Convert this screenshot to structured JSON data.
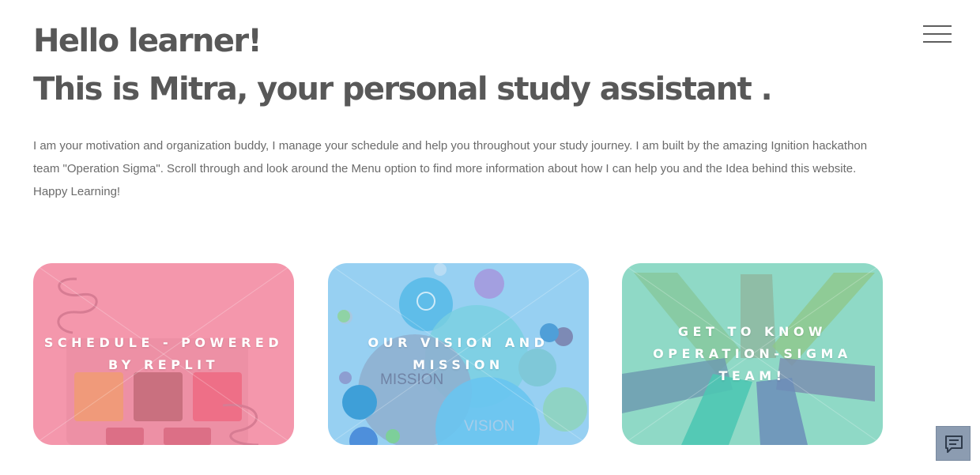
{
  "header": {
    "greeting": "Hello learner!",
    "title": "This is Mitra, your personal study assistant ."
  },
  "intro": {
    "text": "I am your motivation and organization buddy, I manage your schedule and help you throughout your study journey. I am built by the amazing Ignition hackathon team \"Operation Sigma\". Scroll through and look around the Menu option to find more information about how I can help you and the Idea behind this website. Happy Learning!"
  },
  "menu": {
    "icon": "hamburger-menu-icon"
  },
  "cards": [
    {
      "label": "SCHEDULE - POWERED BY REPLIT",
      "color": "#f497ac"
    },
    {
      "label": "OUR VISION AND MISSION",
      "color": "#97d0f2"
    },
    {
      "label": "GET TO KNOW OPERATION-SIGMA TEAM!",
      "color": "#8fd9c6"
    }
  ],
  "card_art_text": {
    "mission": "MISSION",
    "vision": "VISION"
  },
  "chat": {
    "icon": "chat-icon"
  }
}
